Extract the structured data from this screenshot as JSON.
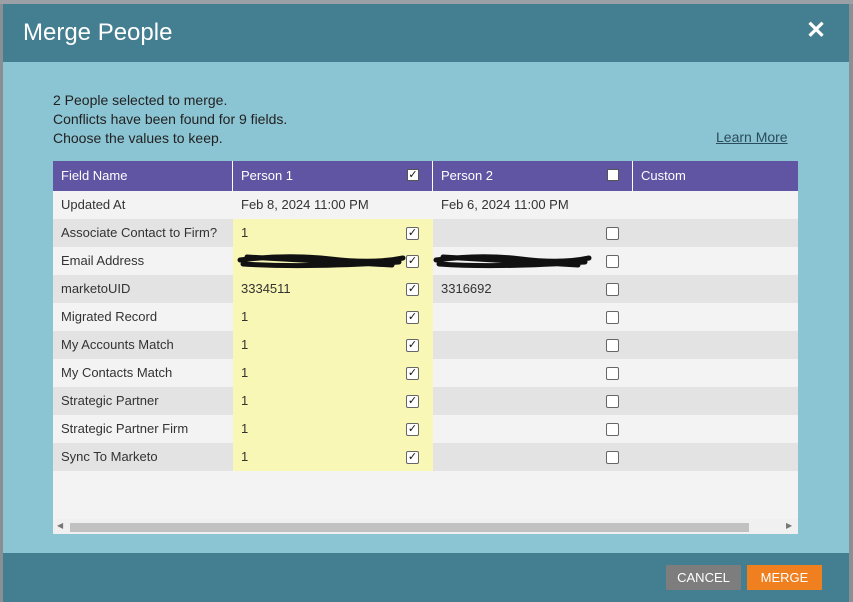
{
  "dialog": {
    "title": "Merge People",
    "close_glyph": "✕",
    "intro_lines": [
      "2 People selected to merge.",
      "Conflicts have been found for 9 fields.",
      "Choose the values to keep."
    ],
    "learn_more": "Learn More"
  },
  "table": {
    "headers": {
      "field": "Field Name",
      "person1": "Person 1",
      "person2": "Person 2",
      "custom": "Custom"
    },
    "header_checks": {
      "person1": true,
      "person2": false
    },
    "rows": [
      {
        "field": "Updated At",
        "p1": "Feb 8, 2024 11:00 PM",
        "p2": "Feb 6, 2024 11:00 PM",
        "p1_checked": null,
        "p2_checked": null
      },
      {
        "field": "Associate Contact to Firm?",
        "p1": "1",
        "p2": "",
        "p1_checked": true,
        "p2_checked": false
      },
      {
        "field": "Email Address",
        "p1": "",
        "p2": "",
        "p1_checked": true,
        "p2_checked": false,
        "redacted": true
      },
      {
        "field": "marketoUID",
        "p1": "3334511",
        "p2": "3316692",
        "p1_checked": true,
        "p2_checked": false
      },
      {
        "field": "Migrated Record",
        "p1": "1",
        "p2": "",
        "p1_checked": true,
        "p2_checked": false
      },
      {
        "field": "My Accounts Match",
        "p1": "1",
        "p2": "",
        "p1_checked": true,
        "p2_checked": false
      },
      {
        "field": "My Contacts Match",
        "p1": "1",
        "p2": "",
        "p1_checked": true,
        "p2_checked": false
      },
      {
        "field": "Strategic Partner",
        "p1": "1",
        "p2": "",
        "p1_checked": true,
        "p2_checked": false
      },
      {
        "field": "Strategic Partner Firm",
        "p1": "1",
        "p2": "",
        "p1_checked": true,
        "p2_checked": false
      },
      {
        "field": "Sync To Marketo",
        "p1": "1",
        "p2": "",
        "p1_checked": true,
        "p2_checked": false
      }
    ]
  },
  "scrollbar": {
    "left_arrow": "◀",
    "right_arrow": "▶"
  },
  "footer": {
    "cancel_label": "CANCEL",
    "merge_label": "MERGE"
  },
  "colors": {
    "title_bar": "#447e91",
    "header": "#5f55a3",
    "person1_highlight": "#f8f7b5",
    "merge_button": "#f07f1f"
  }
}
